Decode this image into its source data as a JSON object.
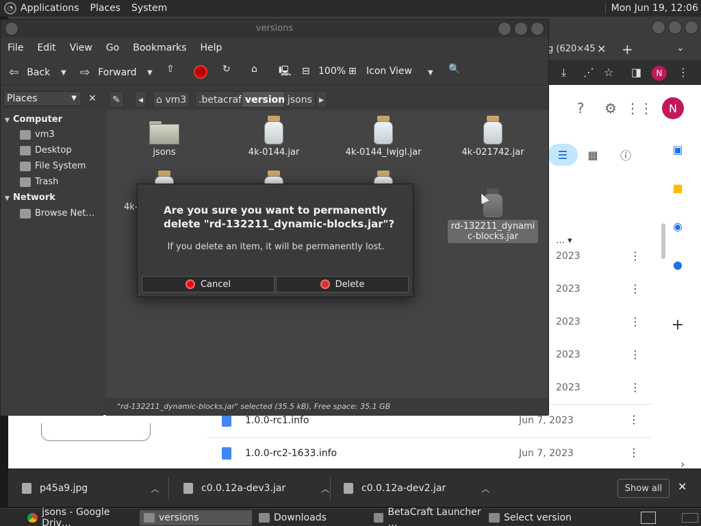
{
  "top_panel": {
    "menus": [
      "Applications",
      "Places",
      "System"
    ],
    "clock": "Mon Jun 19, 12:06"
  },
  "chrome": {
    "tab_fragment": "g (620×45",
    "tab_close": "✕",
    "new_tab": "+",
    "profile_initial": "N",
    "drive": {
      "avatar_initial": "N",
      "sort_fragment": "…",
      "row_dates_partial": [
        "2023",
        "2023",
        "2023",
        "2023",
        "2023"
      ],
      "files": [
        {
          "name": "1.0.0-rc1.info",
          "date": "Jun 7, 2023"
        },
        {
          "name": "1.0.0-rc2-1633.info",
          "date": "Jun 7, 2023"
        }
      ]
    }
  },
  "file_manager": {
    "title": "versions",
    "menu": [
      "File",
      "Edit",
      "View",
      "Go",
      "Bookmarks",
      "Help"
    ],
    "toolbar": {
      "back": "Back",
      "forward": "Forward",
      "zoom": "100%",
      "view_mode": "Icon View"
    },
    "places_label": "Places",
    "breadcrumbs": [
      "vm3",
      ".betacraft",
      "versions",
      "jsons"
    ],
    "active_crumb": "versions",
    "sidebar": {
      "computer_heading": "Computer",
      "computer_items": [
        "vm3",
        "Desktop",
        "File System",
        "Trash"
      ],
      "network_heading": "Network",
      "network_items": [
        "Browse Net…"
      ]
    },
    "files": [
      {
        "name": "jsons",
        "type": "folder"
      },
      {
        "name": "4k-0144.jar",
        "type": "jar"
      },
      {
        "name": "4k-0144_lwjgl.jar",
        "type": "jar"
      },
      {
        "name": "4k-021742.jar",
        "type": "jar"
      },
      {
        "name": "4k-",
        "type": "jar"
      },
      {
        "name": "",
        "type": "jar"
      },
      {
        "name": "",
        "type": "jar"
      },
      {
        "name": "rd-132211_dynamic-blocks.jar",
        "type": "jar",
        "selected": true
      }
    ],
    "status": "\"rd-132211_dynamic-blocks.jar\" selected (35.5 kB), Free space: 35.1 GB"
  },
  "dialog": {
    "title": "Are you sure you want to permanently delete \"rd-132211_dynamic-blocks.jar\"?",
    "message": "If you delete an item, it will be permanently lost.",
    "cancel": "Cancel",
    "delete": "Delete"
  },
  "downloads": {
    "items": [
      "p45a9.jpg",
      "c0.0.12a-dev3.jar",
      "c0.0.12a-dev2.jar"
    ],
    "show_all": "Show all"
  },
  "taskbar": {
    "tasks": [
      "jsons - Google Driv…",
      "versions",
      "Downloads",
      "BetaCraft Launcher …",
      "Select version"
    ],
    "active_task": "versions"
  }
}
